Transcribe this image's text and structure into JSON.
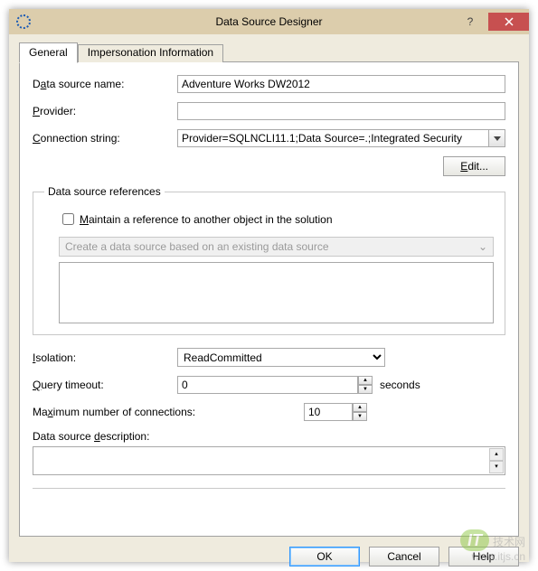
{
  "window": {
    "title": "Data Source Designer"
  },
  "tabs": {
    "general": "General",
    "impersonation": "Impersonation Information"
  },
  "labels": {
    "data_source_name_pre": "D",
    "data_source_name_u": "a",
    "data_source_name_post": "ta source name:",
    "provider_u": "P",
    "provider_post": "rovider:",
    "connection_u": "C",
    "connection_post": "onnection string:",
    "edit_btn_u": "E",
    "edit_btn_post": "dit...",
    "refs_legend": "Data source references",
    "maintain_u": "M",
    "maintain_post": "aintain a reference to another object in the solution",
    "disabled_combo_text": "Create a data source based on an existing data source",
    "isolation_u": "I",
    "isolation_post": "solation:",
    "query_u": "Q",
    "query_post": "uery timeout:",
    "seconds": "seconds",
    "max_pre": "Ma",
    "max_u": "x",
    "max_post": "imum number of connections:",
    "desc_pre": "Data source ",
    "desc_u": "d",
    "desc_post": "escription:"
  },
  "values": {
    "data_source_name": "Adventure Works DW2012",
    "provider": "",
    "connection_string": "Provider=SQLNCLI11.1;Data Source=.;Integrated Security",
    "isolation_selected": "ReadCommitted",
    "query_timeout": "0",
    "max_connections": "10",
    "description": ""
  },
  "dialog_buttons": {
    "ok": "OK",
    "cancel": "Cancel",
    "help": "Help"
  },
  "watermark": {
    "badge": "IT",
    "line1": "技术网",
    "line2": "www.itjs.cn"
  }
}
